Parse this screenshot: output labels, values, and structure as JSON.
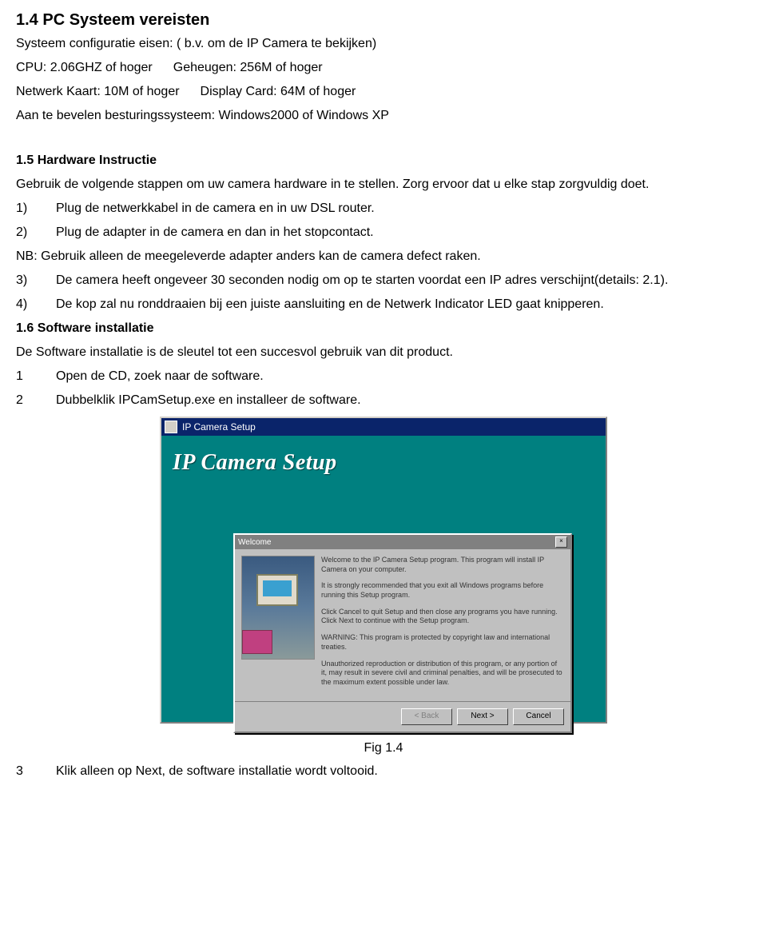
{
  "sections": {
    "s14": {
      "heading": "1.4 PC Systeem vereisten",
      "intro": "Systeem configuratie eisen: ( b.v. om de IP Camera te bekijken)",
      "cpu_label": "CPU:",
      "cpu_value": "2.06GHZ of hoger",
      "mem_label": "Geheugen:",
      "mem_value": "256M of hoger",
      "net_label": "Netwerk Kaart:",
      "net_value": "10M of hoger",
      "disp_label": "Display Card:",
      "disp_value": "64M of hoger",
      "os": "Aan te bevelen besturingssysteem: Windows2000 of Windows XP"
    },
    "s15": {
      "heading": "1.5 Hardware Instructie",
      "intro": "Gebruik de volgende stappen om uw camera hardware in te stellen. Zorg ervoor dat u elke stap zorgvuldig doet.",
      "items": [
        {
          "n": "1)",
          "text": "Plug de netwerkkabel in de camera en in uw DSL router."
        },
        {
          "n": "2)",
          "text": "Plug de adapter in de camera en dan in het stopcontact."
        }
      ],
      "nb": "NB: Gebruik alleen de meegeleverde adapter anders kan de camera defect raken.",
      "items2": [
        {
          "n": "3)",
          "text": "De camera heeft ongeveer 30 seconden nodig om op te starten voordat een IP adres verschijnt(details: 2.1)."
        },
        {
          "n": "4)",
          "text": "De kop zal nu ronddraaien bij een juiste aansluiting en de Netwerk Indicator LED gaat knipperen."
        }
      ]
    },
    "s16": {
      "heading": "1.6 Software installatie",
      "intro": "De Software installatie is de sleutel tot een succesvol gebruik van dit product.",
      "items": [
        {
          "n": "1",
          "text": "Open de CD, zoek naar de software."
        },
        {
          "n": "2",
          "text": "Dubbelklik IPCamSetup.exe en installeer de software."
        }
      ],
      "item3": {
        "n": "3",
        "text": "Klik alleen op Next, de software installatie wordt voltooid."
      }
    }
  },
  "installer": {
    "titlebar": "IP Camera Setup",
    "heading": "IP Camera Setup",
    "dlg_title": "Welcome",
    "close": "×",
    "para1": "Welcome to the IP Camera Setup program. This program will install IP Camera on your computer.",
    "para2": "It is strongly recommended that you exit all Windows programs before running this Setup program.",
    "para3": "Click Cancel to quit Setup and then close any programs you have running. Click Next to continue with the Setup program.",
    "para4": "WARNING: This program is protected by copyright law and international treaties.",
    "para5": "Unauthorized reproduction or distribution of this program, or any portion of it, may result in severe civil and criminal penalties, and will be prosecuted to the maximum extent possible under law.",
    "btn_back": "< Back",
    "btn_next": "Next >",
    "btn_cancel": "Cancel"
  },
  "figure_caption": "Fig 1.4"
}
